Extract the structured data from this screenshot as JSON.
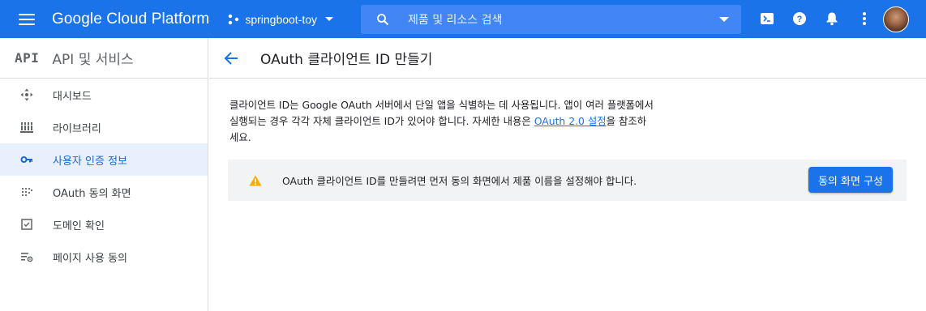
{
  "topbar": {
    "brand": "Google Cloud Platform",
    "project_name": "springboot-toy",
    "search_placeholder": "제품 및 리소스 검색"
  },
  "icons": {
    "menu": "hamburger-menu-icon",
    "project": "project-dots-icon",
    "search": "search-icon",
    "cloud_shell": "terminal-icon",
    "help": "help-icon",
    "notifications": "bell-icon",
    "more": "more-vert-icon",
    "back": "arrow-back-icon",
    "warning": "warning-icon"
  },
  "colors": {
    "topbar": "#1a73e8",
    "search": "#4285f4",
    "active_bg": "#e8f0fe",
    "active_text": "#1967d2",
    "warning": "#f9ab00",
    "notice_bg": "#f1f3f4"
  },
  "sidebar": {
    "logo": "API",
    "title": "API 및 서비스",
    "items": [
      {
        "label": "대시보드",
        "icon": "dashboard-icon",
        "active": false
      },
      {
        "label": "라이브러리",
        "icon": "library-icon",
        "active": false
      },
      {
        "label": "사용자 인증 정보",
        "icon": "key-icon",
        "active": true
      },
      {
        "label": "OAuth 동의 화면",
        "icon": "consent-dots-icon",
        "active": false
      },
      {
        "label": "도메인 확인",
        "icon": "checkbox-icon",
        "active": false
      },
      {
        "label": "페이지 사용 동의",
        "icon": "list-settings-icon",
        "active": false
      }
    ]
  },
  "main": {
    "title": "OAuth 클라이언트 ID 만들기",
    "description_part1": "클라이언트 ID는 Google OAuth 서버에서 단일 앱을 식별하는 데 사용됩니다. 앱이 여러 플랫폼에서 실행되는 경우 각각 자체 클라이언트 ID가 있어야 합니다. 자세한 내용은 ",
    "description_link": "OAuth 2.0 설정",
    "description_part2": "을 참조하세요.",
    "notice_text": "OAuth 클라이언트 ID를 만들려면 먼저 동의 화면에서 제품 이름을 설정해야 합니다.",
    "notice_button": "동의 화면 구성"
  }
}
